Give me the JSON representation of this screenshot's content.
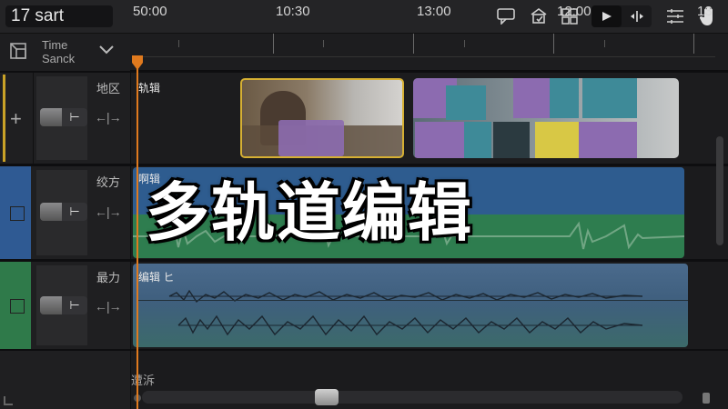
{
  "topbar": {
    "project_name": "17 sart",
    "icons": [
      "comment-icon",
      "share-icon",
      "grid-icon",
      "flag-icon",
      "split-icon",
      "list-icon",
      "hand-icon"
    ]
  },
  "header": {
    "column_label_line1": "Time",
    "column_label_line2": "Sanck"
  },
  "ruler": {
    "labels": [
      "50:00",
      "10:30",
      "13:00",
      "12:00",
      "13"
    ]
  },
  "tracks": [
    {
      "label": "地区",
      "clip_label": "轨辑",
      "color": "#c9a227"
    },
    {
      "label": "绞方",
      "clip_label": "啊辑",
      "color": "#2f5a93"
    },
    {
      "label": "最力",
      "clip_label": "编辑 ヒ",
      "color": "#2f7a4a"
    }
  ],
  "footer": {
    "label": "遭泝"
  },
  "overlay": {
    "title": "多轨道编辑"
  },
  "colors": {
    "playhead": "#e07a1e",
    "video_selected_border": "#d6b033",
    "audio_blue": "#2e5c8f",
    "audio_green": "#2e7d4f"
  }
}
